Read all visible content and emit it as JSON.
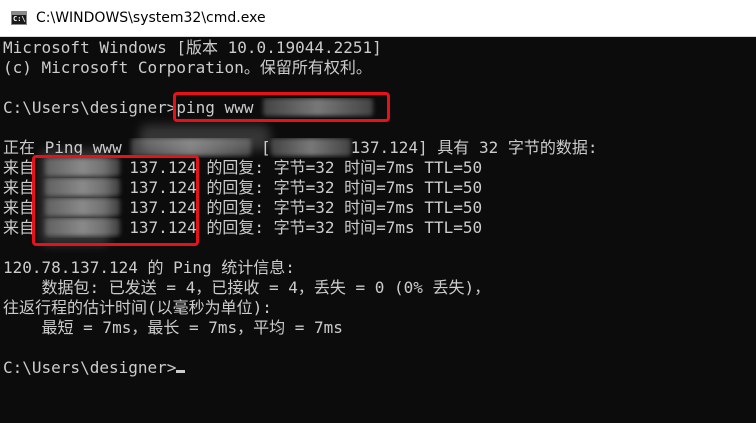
{
  "window": {
    "title": "C:\\WINDOWS\\system32\\cmd.exe",
    "icon": "cmd-icon",
    "icon_glyph": "C:\\."
  },
  "console": {
    "banner1": "Microsoft Windows [版本 10.0.19044.2251]",
    "banner2": "(c) Microsoft Corporation。保留所有权利。",
    "prompt": "C:\\Users\\designer>",
    "command": "ping www",
    "ping_prefix": "正在 Ping www",
    "ping_bracket": " [",
    "ping_suffix": "137.124] 具有 32 字节的数据:",
    "reply_prefix": "来自 ",
    "reply_ip_tail": "137.124",
    "reply_suffix": " 的回复: 字节=32 时间=7ms TTL=50",
    "stats_header": "120.78.137.124 的 Ping 统计信息:",
    "packets": "    数据包: 已发送 = 4，已接收 = 4，丢失 = 0 (0% 丢失)，",
    "rtt_header": "往返行程的估计时间(以毫秒为单位):",
    "rtt_values": "    最短 = 7ms，最长 = 7ms，平均 = 7ms",
    "final_prompt": "C:\\Users\\designer>"
  },
  "colors": {
    "console_bg": "#0c0c0c",
    "console_fg": "#cccccc",
    "annotation": "#e8111a"
  }
}
